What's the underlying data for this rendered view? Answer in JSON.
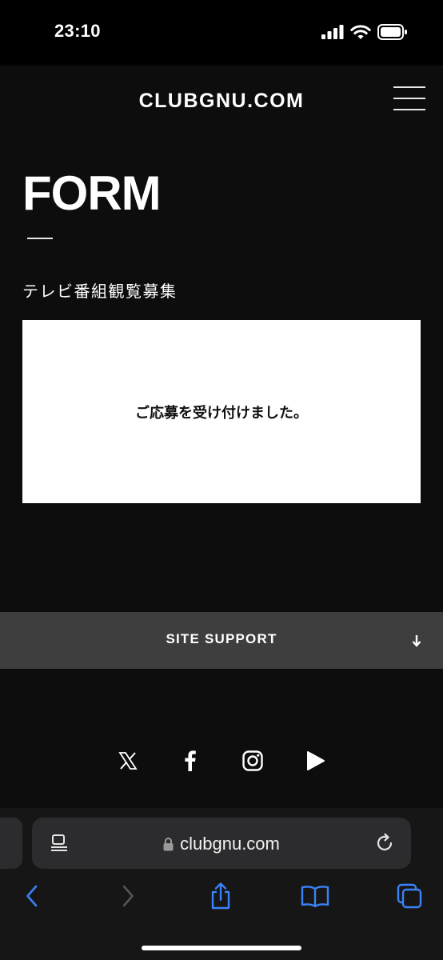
{
  "status_bar": {
    "time": "23:10"
  },
  "site": {
    "logo": "CLUBGNU.COM",
    "page_heading": "FORM",
    "form_subtitle": "テレビ番組観覧募集",
    "confirmation_message": "ご応募を受け付けました。",
    "site_support_label": "SITE SUPPORT",
    "social_links": [
      "x-icon",
      "facebook-icon",
      "instagram-icon",
      "youtube-play-icon"
    ]
  },
  "browser": {
    "url": "clubgnu.com",
    "accent_color": "#3a82f7"
  },
  "colors": {
    "page_background": "#0d0d0d",
    "message_box": "#ffffff",
    "support_bar": "#3e3e3e"
  }
}
